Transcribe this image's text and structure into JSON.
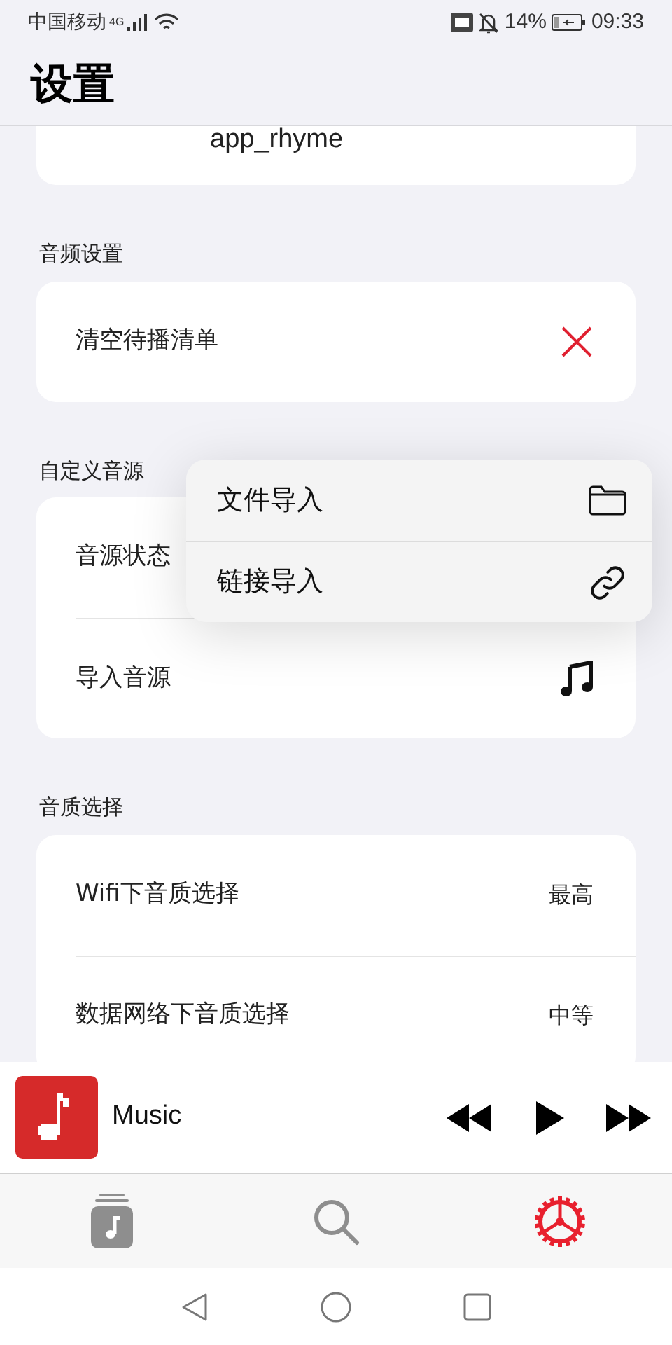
{
  "status_bar": {
    "carrier": "中国移动",
    "network": "4G",
    "battery": "14%",
    "time": "09:33"
  },
  "header": {
    "title": "设置"
  },
  "top_card": {
    "value": "app_rhyme"
  },
  "sections": [
    {
      "title": "音频设置",
      "rows": [
        {
          "kind": "clear",
          "label": "清空待播清单"
        }
      ]
    },
    {
      "title": "自定义音源",
      "rows": [
        {
          "kind": "plain",
          "label": "音源状态"
        },
        {
          "kind": "music",
          "label": "导入音源"
        }
      ]
    },
    {
      "title": "音质选择",
      "rows": [
        {
          "kind": "value",
          "label": "Wifi下音质选择",
          "value": "最高"
        },
        {
          "kind": "value",
          "label": "数据网络下音质选择",
          "value": "中等"
        }
      ]
    }
  ],
  "popup_menu": [
    {
      "kind": "folder",
      "label": "文件导入"
    },
    {
      "kind": "link",
      "label": "链接导入"
    }
  ],
  "player": {
    "title": "Music"
  },
  "tabs": [
    {
      "kind": "library",
      "selected": false
    },
    {
      "kind": "search",
      "selected": false
    },
    {
      "kind": "settings",
      "selected": true
    }
  ]
}
